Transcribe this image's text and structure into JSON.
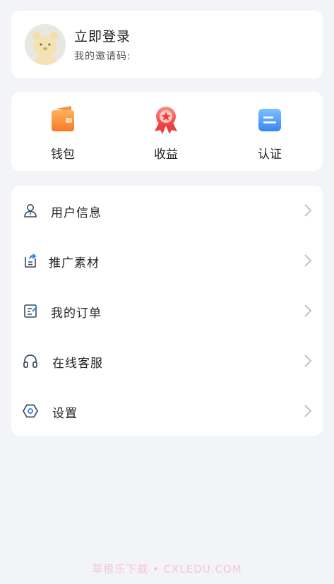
{
  "profile": {
    "login_label": "立即登录",
    "invite_label": "我的邀请码:",
    "avatar_icon": "bear-avatar-icon"
  },
  "actions": [
    {
      "label": "钱包",
      "icon": "wallet-icon",
      "color": "#f97d2c"
    },
    {
      "label": "收益",
      "icon": "medal-icon",
      "color": "#f2494a"
    },
    {
      "label": "认证",
      "icon": "id-card-icon",
      "color": "#3d8cf5"
    }
  ],
  "menu": [
    {
      "label": "用户信息",
      "icon": "user-icon"
    },
    {
      "label": "推广素材",
      "icon": "share-document-icon"
    },
    {
      "label": "我的订单",
      "icon": "order-edit-icon"
    },
    {
      "label": "在线客服",
      "icon": "headset-icon"
    },
    {
      "label": "设置",
      "icon": "settings-hexagon-icon"
    }
  ],
  "watermark": "草根乐下载 • CXLEDU.COM",
  "colors": {
    "background": "#f2f4f8",
    "card": "#ffffff",
    "icon_stroke": "#3a4a5c",
    "chevron": "#b7bcc4"
  }
}
